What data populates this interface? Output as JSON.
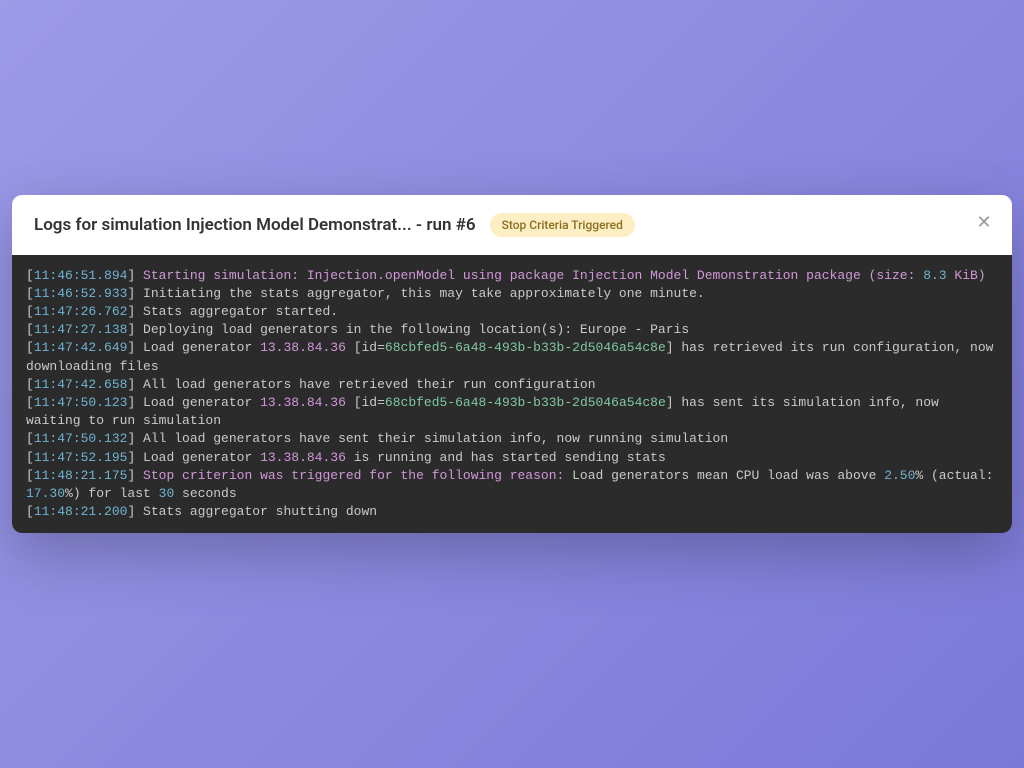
{
  "header": {
    "title_prefix": "Logs for simulation",
    "sim_name": "Injection Model Demonstrat...",
    "run_label": "- run #6",
    "badge": "Stop Criteria Triggered"
  },
  "logs": [
    {
      "ts": "11:46:51.894",
      "parts": [
        {
          "t": "hl",
          "v": "Starting simulation: Injection.openModel using package Injection Model Demonstration package (size: "
        },
        {
          "t": "num",
          "v": "8.3"
        },
        {
          "t": "hl",
          "v": " KiB)"
        }
      ]
    },
    {
      "ts": "11:46:52.933",
      "parts": [
        {
          "t": "plain",
          "v": "Initiating the stats aggregator, this may take approximately one minute."
        }
      ]
    },
    {
      "ts": "11:47:26.762",
      "parts": [
        {
          "t": "plain",
          "v": "Stats aggregator started."
        }
      ]
    },
    {
      "ts": "11:47:27.138",
      "parts": [
        {
          "t": "plain",
          "v": "Deploying load generators in the following location(s): Europe - Paris"
        }
      ]
    },
    {
      "ts": "11:47:42.649",
      "parts": [
        {
          "t": "plain",
          "v": "Load generator "
        },
        {
          "t": "ip",
          "v": "13.38.84.36"
        },
        {
          "t": "plain",
          "v": " [id="
        },
        {
          "t": "id",
          "v": "68cbfed5-6a48-493b-b33b-2d5046a54c8e"
        },
        {
          "t": "plain",
          "v": "] has retrieved its run configuration, now downloading files"
        }
      ]
    },
    {
      "ts": "11:47:42.658",
      "parts": [
        {
          "t": "plain",
          "v": "All load generators have retrieved their run configuration"
        }
      ]
    },
    {
      "ts": "11:47:50.123",
      "parts": [
        {
          "t": "plain",
          "v": "Load generator "
        },
        {
          "t": "ip",
          "v": "13.38.84.36"
        },
        {
          "t": "plain",
          "v": " [id="
        },
        {
          "t": "id",
          "v": "68cbfed5-6a48-493b-b33b-2d5046a54c8e"
        },
        {
          "t": "plain",
          "v": "] has sent its simulation info, now waiting to run simulation"
        }
      ]
    },
    {
      "ts": "11:47:50.132",
      "parts": [
        {
          "t": "plain",
          "v": "All load generators have sent their simulation info, now running simulation"
        }
      ]
    },
    {
      "ts": "11:47:52.195",
      "parts": [
        {
          "t": "plain",
          "v": "Load generator "
        },
        {
          "t": "ip",
          "v": "13.38.84.36"
        },
        {
          "t": "plain",
          "v": " is running and has started sending stats"
        }
      ]
    },
    {
      "ts": "11:48:21.175",
      "parts": [
        {
          "t": "hl",
          "v": "Stop criterion was triggered for the following reason: "
        },
        {
          "t": "plain",
          "v": "Load generators mean CPU load was above "
        },
        {
          "t": "num",
          "v": "2.50"
        },
        {
          "t": "plain",
          "v": "% (actual: "
        },
        {
          "t": "num",
          "v": "17.30"
        },
        {
          "t": "plain",
          "v": "%) for last "
        },
        {
          "t": "num",
          "v": "30"
        },
        {
          "t": "plain",
          "v": " seconds"
        }
      ]
    },
    {
      "ts": "11:48:21.200",
      "parts": [
        {
          "t": "plain",
          "v": "Stats aggregator shutting down"
        }
      ]
    }
  ]
}
